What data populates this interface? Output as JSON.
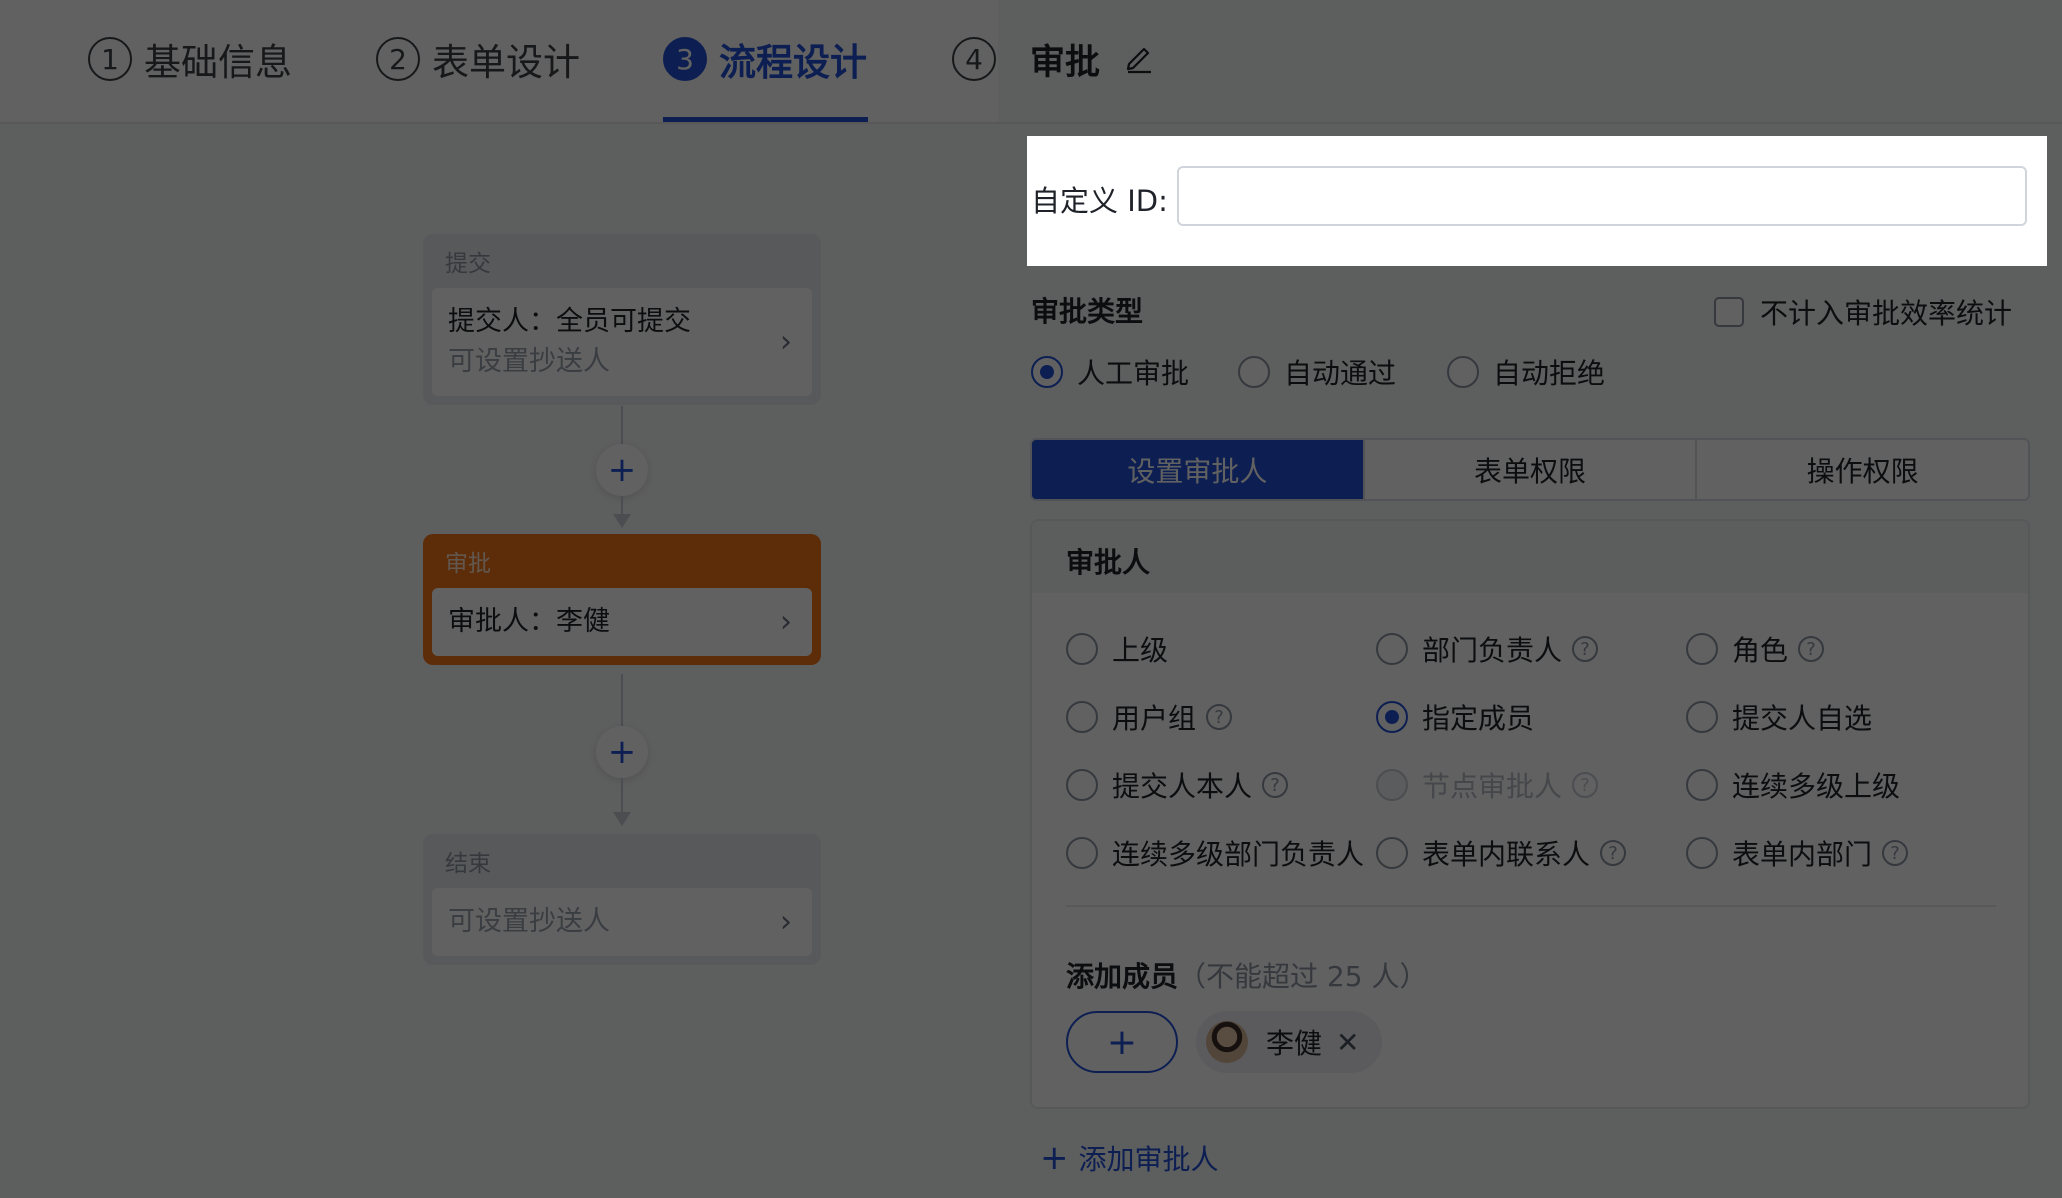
{
  "steps": [
    {
      "num": "1",
      "label": "基础信息"
    },
    {
      "num": "2",
      "label": "表单设计"
    },
    {
      "num": "3",
      "label": "流程设计"
    },
    {
      "num": "4",
      "label": ""
    }
  ],
  "flow": {
    "submit": {
      "head": "提交",
      "line1": "提交人：全员可提交",
      "line2": "可设置抄送人"
    },
    "approve": {
      "head": "审批",
      "line1": "审批人：李健"
    },
    "end": {
      "head": "结束",
      "line1": "可设置抄送人"
    },
    "add_symbol": "+",
    "chevron": "›"
  },
  "panel": {
    "title": "审批",
    "custom_id_label": "自定义 ID:",
    "custom_id_value": "",
    "approval_type_title": "审批类型",
    "exclude_stats_label": "不计入审批效率统计",
    "approval_types": [
      "人工审批",
      "自动通过",
      "自动拒绝"
    ],
    "approval_type_selected": "人工审批",
    "tabs": [
      "设置审批人",
      "表单权限",
      "操作权限"
    ],
    "approver_title": "审批人",
    "approver_options": [
      {
        "label": "上级",
        "help": false,
        "checked": false,
        "disabled": false
      },
      {
        "label": "部门负责人",
        "help": true,
        "checked": false,
        "disabled": false
      },
      {
        "label": "角色",
        "help": true,
        "checked": false,
        "disabled": false
      },
      {
        "label": "用户组",
        "help": true,
        "checked": false,
        "disabled": false
      },
      {
        "label": "指定成员",
        "help": false,
        "checked": true,
        "disabled": false
      },
      {
        "label": "提交人自选",
        "help": false,
        "checked": false,
        "disabled": false
      },
      {
        "label": "提交人本人",
        "help": true,
        "checked": false,
        "disabled": false
      },
      {
        "label": "节点审批人",
        "help": true,
        "checked": false,
        "disabled": true
      },
      {
        "label": "连续多级上级",
        "help": false,
        "checked": false,
        "disabled": false
      },
      {
        "label": "连续多级部门负责人",
        "help": false,
        "checked": false,
        "disabled": false
      },
      {
        "label": "表单内联系人",
        "help": true,
        "checked": false,
        "disabled": false
      },
      {
        "label": "表单内部门",
        "help": true,
        "checked": false,
        "disabled": false
      }
    ],
    "help_symbol": "?",
    "add_member_label": "添加成员",
    "add_member_hint": "（不能超过 25 人）",
    "add_button_symbol": "+",
    "member_name": "李健",
    "remove_symbol": "✕",
    "add_approver_label": "添加审批人"
  },
  "colors": {
    "accent": "#2352d8",
    "approve_node": "#f57316"
  }
}
